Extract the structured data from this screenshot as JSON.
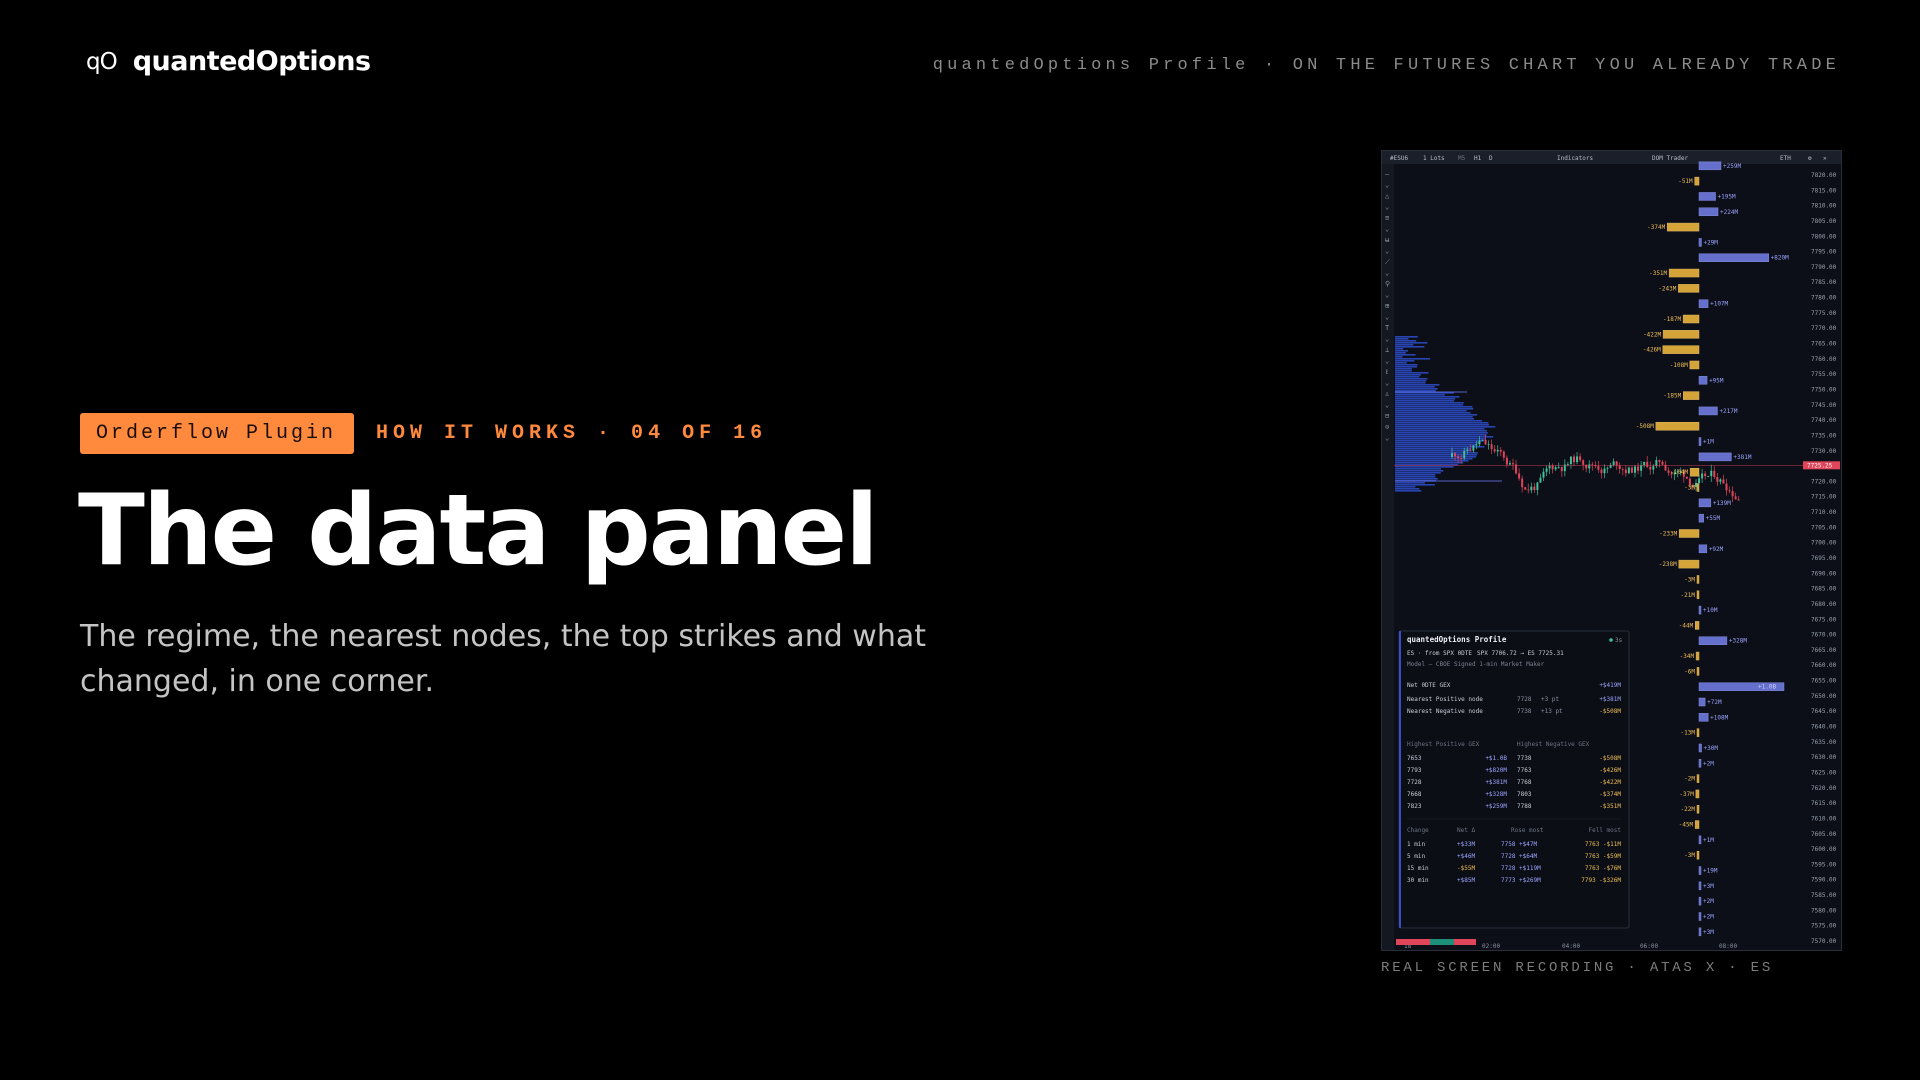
{
  "brand": {
    "mark": "qO",
    "name": "quantedOptions"
  },
  "top_tagline": "quantedOptions Profile · ON THE FUTURES CHART YOU ALREADY TRADE",
  "eyebrow": {
    "badge": "Orderflow Plugin",
    "step": "HOW IT WORKS · 04 OF 16"
  },
  "title": "The data panel",
  "subtitle": "The regime, the nearest nodes, the top strikes and what changed, in one corner.",
  "caption": "REAL SCREEN RECORDING · ATAS X · ES",
  "colors": {
    "accent": "#ff8a3d",
    "positive": "#6f7be0",
    "negative": "#e5b13c",
    "price_line": "#e0455a",
    "profile": "#2f4fd0"
  },
  "chart_toolbar": {
    "symbol": "#ESU6",
    "lots": "1 Lots",
    "tf1": "M5",
    "tf2": "H1",
    "tf3": "D",
    "indicators": "Indicators",
    "dom": "DOM Trader",
    "session": "ETH"
  },
  "price_axis": {
    "ticks": [
      "7820.00",
      "7815.00",
      "7810.00",
      "7805.00",
      "7800.00",
      "7795.00",
      "7790.00",
      "7785.00",
      "7780.00",
      "7775.00",
      "7770.00",
      "7765.00",
      "7760.00",
      "7755.00",
      "7750.00",
      "7745.00",
      "7740.00",
      "7735.00",
      "7730.00",
      "7725.00",
      "7720.00",
      "7715.00",
      "7710.00",
      "7705.00",
      "7700.00",
      "7695.00",
      "7690.00",
      "7685.00",
      "7680.00",
      "7675.00",
      "7670.00",
      "7665.00",
      "7660.00",
      "7655.00",
      "7650.00",
      "7645.00",
      "7640.00",
      "7635.00",
      "7630.00",
      "7625.00",
      "7620.00",
      "7615.00",
      "7610.00",
      "7605.00",
      "7600.00",
      "7595.00",
      "7590.00",
      "7585.00",
      "7580.00",
      "7575.00",
      "7570.00"
    ],
    "current_price": "7725.25"
  },
  "time_axis": [
    "18",
    "02:00",
    "04:00",
    "06:00",
    "08:00"
  ],
  "gex_bars": [
    {
      "price": 7823,
      "label": "+259M",
      "value": 259
    },
    {
      "price": 7818,
      "label": "-51M",
      "value": -51
    },
    {
      "price": 7813,
      "label": "+195M",
      "value": 195
    },
    {
      "price": 7808,
      "label": "+224M",
      "value": 224
    },
    {
      "price": 7803,
      "label": "-374M",
      "value": -374
    },
    {
      "price": 7798,
      "label": "+29M",
      "value": 29
    },
    {
      "price": 7793,
      "label": "+820M",
      "value": 820
    },
    {
      "price": 7788,
      "label": "-351M",
      "value": -351
    },
    {
      "price": 7783,
      "label": "-243M",
      "value": -243
    },
    {
      "price": 7778,
      "label": "+107M",
      "value": 107
    },
    {
      "price": 7773,
      "label": "-187M",
      "value": -187
    },
    {
      "price": 7768,
      "label": "-422M",
      "value": -422
    },
    {
      "price": 7763,
      "label": "-426M",
      "value": -426
    },
    {
      "price": 7758,
      "label": "-108M",
      "value": -108
    },
    {
      "price": 7753,
      "label": "+95M",
      "value": 95
    },
    {
      "price": 7748,
      "label": "-185M",
      "value": -185
    },
    {
      "price": 7743,
      "label": "+217M",
      "value": 217
    },
    {
      "price": 7738,
      "label": "-508M",
      "value": -508
    },
    {
      "price": 7733,
      "label": "+1M",
      "value": 1
    },
    {
      "price": 7728,
      "label": "+381M",
      "value": 381
    },
    {
      "price": 7723,
      "label": "-104M",
      "value": -104
    },
    {
      "price": 7718,
      "label": "-3M",
      "value": -3
    },
    {
      "price": 7713,
      "label": "+139M",
      "value": 139
    },
    {
      "price": 7708,
      "label": "+55M",
      "value": 55
    },
    {
      "price": 7703,
      "label": "-233M",
      "value": -233
    },
    {
      "price": 7698,
      "label": "+92M",
      "value": 92
    },
    {
      "price": 7693,
      "label": "-238M",
      "value": -238
    },
    {
      "price": 7688,
      "label": "-3M",
      "value": -3
    },
    {
      "price": 7683,
      "label": "-21M",
      "value": -21
    },
    {
      "price": 7678,
      "label": "+10M",
      "value": 10
    },
    {
      "price": 7673,
      "label": "-44M",
      "value": -44
    },
    {
      "price": 7668,
      "label": "+328M",
      "value": 328
    },
    {
      "price": 7663,
      "label": "-34M",
      "value": -34
    },
    {
      "price": 7658,
      "label": "-6M",
      "value": -6
    },
    {
      "price": 7653,
      "label": "+1.0B",
      "value": 1000
    },
    {
      "price": 7648,
      "label": "+72M",
      "value": 72
    },
    {
      "price": 7643,
      "label": "+108M",
      "value": 108
    },
    {
      "price": 7638,
      "label": "-13M",
      "value": -13
    },
    {
      "price": 7633,
      "label": "+30M",
      "value": 30
    },
    {
      "price": 7628,
      "label": "+2M",
      "value": 2
    },
    {
      "price": 7623,
      "label": "-2M",
      "value": -2
    },
    {
      "price": 7618,
      "label": "-37M",
      "value": -37
    },
    {
      "price": 7613,
      "label": "-22M",
      "value": -22
    },
    {
      "price": 7608,
      "label": "-45M",
      "value": -45
    },
    {
      "price": 7603,
      "label": "+1M",
      "value": 1
    },
    {
      "price": 7598,
      "label": "-3M",
      "value": -3
    },
    {
      "price": 7593,
      "label": "+19M",
      "value": 19
    },
    {
      "price": 7588,
      "label": "+3M",
      "value": 3
    },
    {
      "price": 7583,
      "label": "+2M",
      "value": 2
    },
    {
      "price": 7578,
      "label": "+2M",
      "value": 2
    },
    {
      "price": 7573,
      "label": "+3M",
      "value": 3
    }
  ],
  "data_panel": {
    "title": "quantedOptions Profile",
    "status": "3s",
    "source": "ES · from SPX 0DTE",
    "conversion": "SPX 7706.72 → ES 7725.31",
    "model": "Model — CBOE Signed 1-min Market Maker",
    "net_label": "Net 0DTE GEX",
    "net_value": "+$419M",
    "nearest": [
      {
        "label": "Nearest Positive node",
        "strike": "7728",
        "dist": "+3 pt",
        "value": "+$381M",
        "sign": "pos"
      },
      {
        "label": "Nearest Negative node",
        "strike": "7738",
        "dist": "+13 pt",
        "value": "-$508M",
        "sign": "neg"
      }
    ],
    "highest_pos_header": "Highest Positive GEX",
    "highest_neg_header": "Highest Negative GEX",
    "top_strikes": [
      {
        "pos_strike": "7653",
        "pos_value": "+$1.0B",
        "neg_strike": "7738",
        "neg_value": "-$508M"
      },
      {
        "pos_strike": "7793",
        "pos_value": "+$820M",
        "neg_strike": "7763",
        "neg_value": "-$426M"
      },
      {
        "pos_strike": "7728",
        "pos_value": "+$381M",
        "neg_strike": "7768",
        "neg_value": "-$422M"
      },
      {
        "pos_strike": "7668",
        "pos_value": "+$328M",
        "neg_strike": "7803",
        "neg_value": "-$374M"
      },
      {
        "pos_strike": "7823",
        "pos_value": "+$259M",
        "neg_strike": "7788",
        "neg_value": "-$351M"
      }
    ],
    "change_headers": [
      "Change",
      "Net Δ",
      "Rose most",
      "Fell most"
    ],
    "changes": [
      {
        "period": "1 min",
        "net": "+$33M",
        "rose": "7758 +$47M",
        "fell": "7763 -$11M",
        "net_sign": "pos"
      },
      {
        "period": "5 min",
        "net": "+$46M",
        "rose": "7728 +$64M",
        "fell": "7763 -$59M",
        "net_sign": "pos"
      },
      {
        "period": "15 min",
        "net": "-$55M",
        "rose": "7728 +$119M",
        "fell": "7763 -$76M",
        "net_sign": "neg"
      },
      {
        "period": "30 min",
        "net": "+$85M",
        "rose": "7773 +$269M",
        "fell": "7793 -$326M",
        "net_sign": "pos"
      }
    ]
  }
}
